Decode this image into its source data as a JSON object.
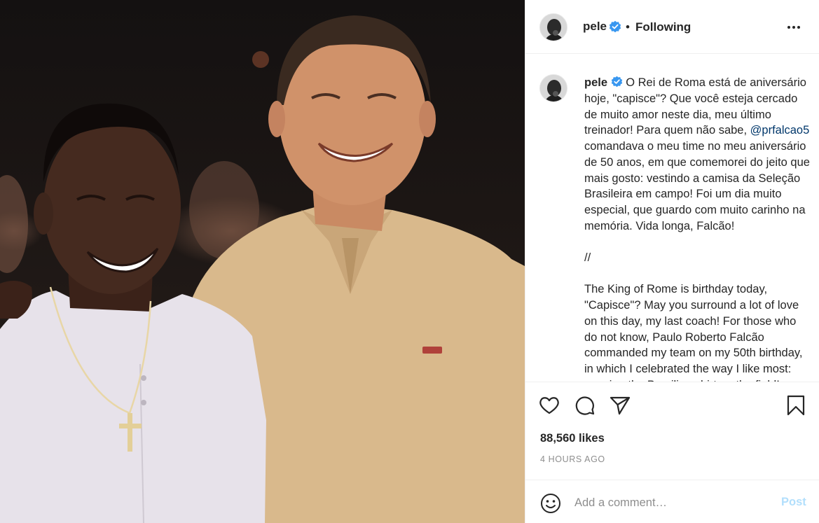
{
  "post": {
    "username": "pele",
    "follow_status": "Following",
    "separator": "•",
    "caption_pt_1": "O Rei de Roma está de aniversário hoje, \"capisce\"? Que você esteja cercado de muito amor neste dia, meu último treinador! Para quem não sabe, ",
    "mention": "@prfalcao5",
    "caption_pt_2": " comandava o meu time no meu aniversário de 50 anos, em que comemorei do jeito que mais gosto: vestindo a camisa da Seleção Brasileira em campo! Foi um dia muito especial, que guardo com muito carinho na memória. Vida longa, Falcão!",
    "divider": "//",
    "caption_en": "The King of Rome is birthday today, \"Capisce\"? May you surround a lot of love on this day, my last coach! For those who do not know, Paulo Roberto Falcão commanded my team on my 50th birthday, in which I celebrated the way I like most: wearing the Brazilian shirt on the field!",
    "likes": "88,560 likes",
    "time_ago": "4 HOURS AGO"
  },
  "comment": {
    "placeholder": "Add a comment…",
    "post_label": "Post"
  },
  "icons": {
    "more": "more-options-icon",
    "verified": "verified-badge-icon",
    "like": "heart-icon",
    "comment": "comment-icon",
    "share": "paper-plane-icon",
    "save": "bookmark-icon",
    "emoji": "emoji-icon"
  },
  "colors": {
    "verified_blue": "#3897f0",
    "mention_blue": "#00376b",
    "post_button_disabled": "#b2dffc",
    "muted_text": "#8e8e8e",
    "border": "#efefef"
  }
}
